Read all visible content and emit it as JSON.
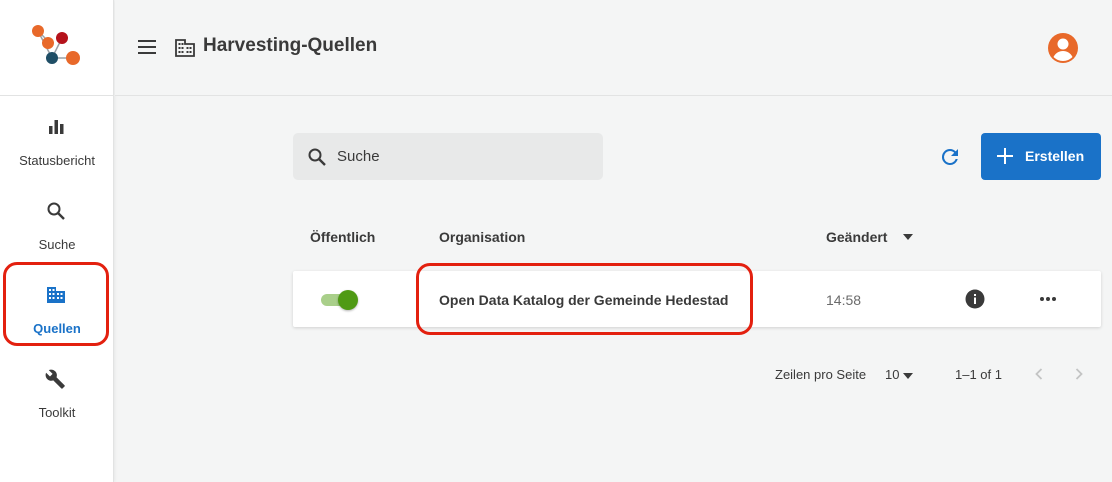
{
  "sidebar": {
    "items": [
      {
        "label": "Statusbericht",
        "icon": "bar-chart-icon"
      },
      {
        "label": "Suche",
        "icon": "search-icon"
      },
      {
        "label": "Quellen",
        "icon": "building-icon",
        "active": true
      },
      {
        "label": "Toolkit",
        "icon": "wrench-icon"
      }
    ]
  },
  "header": {
    "title": "Harvesting-Quellen",
    "title_icon": "building-icon",
    "menu_icon": "hamburger-icon",
    "avatar_icon": "account-circle-icon"
  },
  "toolbar": {
    "search_placeholder": "Suche",
    "refresh_icon": "refresh-icon",
    "create_label": "Erstellen"
  },
  "table": {
    "columns": [
      "Öffentlich",
      "Organisation",
      "Geändert"
    ],
    "sort_column": "Geändert",
    "rows": [
      {
        "public": true,
        "organisation": "Open Data Katalog der Gemeinde Hedestad",
        "changed": "14:58"
      }
    ]
  },
  "pagination": {
    "rows_per_page_label": "Zeilen pro Seite",
    "rows_per_page": "10",
    "range": "1–1 of 1"
  },
  "colors": {
    "accent": "#1a72c8",
    "toggle_on": "#4f9a14",
    "avatar": "#e8692a",
    "highlight": "#e3200f"
  }
}
